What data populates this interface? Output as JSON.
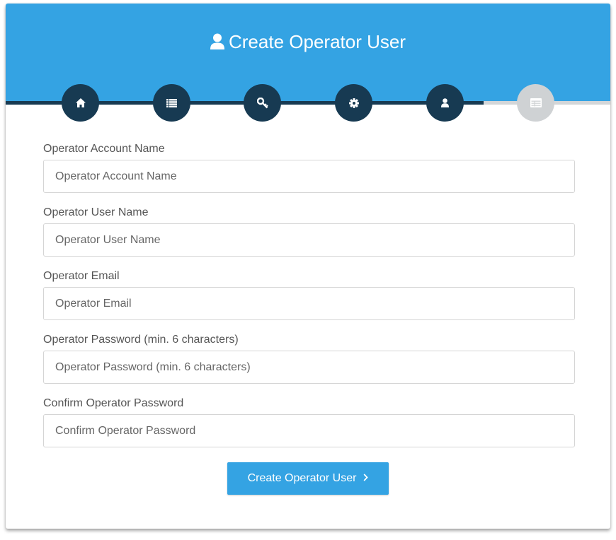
{
  "header": {
    "title": "Create Operator User",
    "title_icon": "user-icon",
    "background": "#34a3e3"
  },
  "wizard": {
    "progress": 0.79,
    "active_color": "#173a52",
    "inactive_color": "#cfd2d4",
    "steps": [
      {
        "icon": "home-icon",
        "state": "complete"
      },
      {
        "icon": "list-icon",
        "state": "complete"
      },
      {
        "icon": "key-icon",
        "state": "complete"
      },
      {
        "icon": "gear-icon",
        "state": "complete"
      },
      {
        "icon": "user-icon",
        "state": "current"
      },
      {
        "icon": "table-icon",
        "state": "pending"
      }
    ]
  },
  "form": {
    "fields": [
      {
        "label": "Operator Account Name",
        "placeholder": "Operator Account Name",
        "value": ""
      },
      {
        "label": "Operator User Name",
        "placeholder": "Operator User Name",
        "value": ""
      },
      {
        "label": "Operator Email",
        "placeholder": "Operator Email",
        "value": ""
      },
      {
        "label": "Operator Password (min. 6 characters)",
        "placeholder": "Operator Password (min. 6 characters)",
        "value": ""
      },
      {
        "label": "Confirm Operator Password",
        "placeholder": "Confirm Operator Password",
        "value": ""
      }
    ],
    "submit_label": "Create Operator User",
    "submit_icon": "chevron-right-icon"
  }
}
